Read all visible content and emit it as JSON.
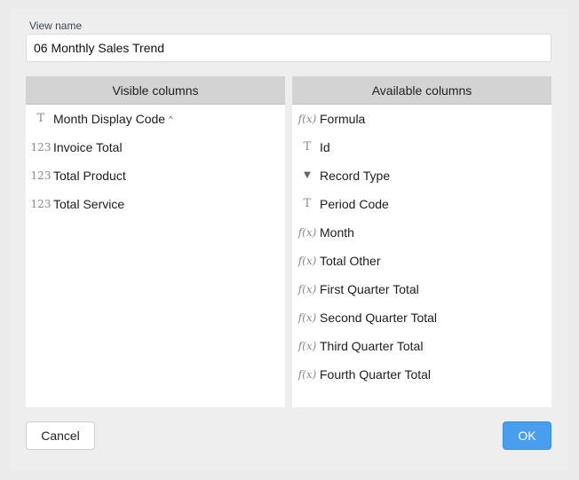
{
  "dialog": {
    "view_name_label": "View name",
    "view_name_value": "06 Monthly Sales Trend",
    "cancel_label": "Cancel",
    "ok_label": "OK"
  },
  "visible_columns": {
    "header": "Visible columns",
    "items": [
      {
        "label": "Month Display Code",
        "type_glyph": "T",
        "icon": "text-type-icon",
        "sort": "ascending",
        "sort_glyph": "^"
      },
      {
        "label": "Invoice Total",
        "type_glyph": "123",
        "icon": "number-type-icon"
      },
      {
        "label": "Total Product",
        "type_glyph": "123",
        "icon": "number-type-icon"
      },
      {
        "label": "Total Service",
        "type_glyph": "123",
        "icon": "number-type-icon"
      }
    ]
  },
  "available_columns": {
    "header": "Available columns",
    "items": [
      {
        "label": "Formula",
        "type_glyph": "f(x)",
        "icon": "formula-type-icon"
      },
      {
        "label": "Id",
        "type_glyph": "T",
        "icon": "text-type-icon"
      },
      {
        "label": "Record Type",
        "type_glyph": "▼",
        "icon": "dropdown-type-icon"
      },
      {
        "label": "Period Code",
        "type_glyph": "T",
        "icon": "text-type-icon"
      },
      {
        "label": "Month",
        "type_glyph": "f(x)",
        "icon": "formula-type-icon"
      },
      {
        "label": "Total Other",
        "type_glyph": "f(x)",
        "icon": "formula-type-icon"
      },
      {
        "label": "First Quarter Total",
        "type_glyph": "f(x)",
        "icon": "formula-type-icon"
      },
      {
        "label": "Second Quarter Total",
        "type_glyph": "f(x)",
        "icon": "formula-type-icon"
      },
      {
        "label": "Third Quarter Total",
        "type_glyph": "f(x)",
        "icon": "formula-type-icon"
      },
      {
        "label": "Fourth Quarter Total",
        "type_glyph": "f(x)",
        "icon": "formula-type-icon"
      }
    ]
  },
  "colors": {
    "primary_button": "#4a9ef0",
    "panel_header": "#d3d3d3",
    "background": "#ebebeb"
  }
}
